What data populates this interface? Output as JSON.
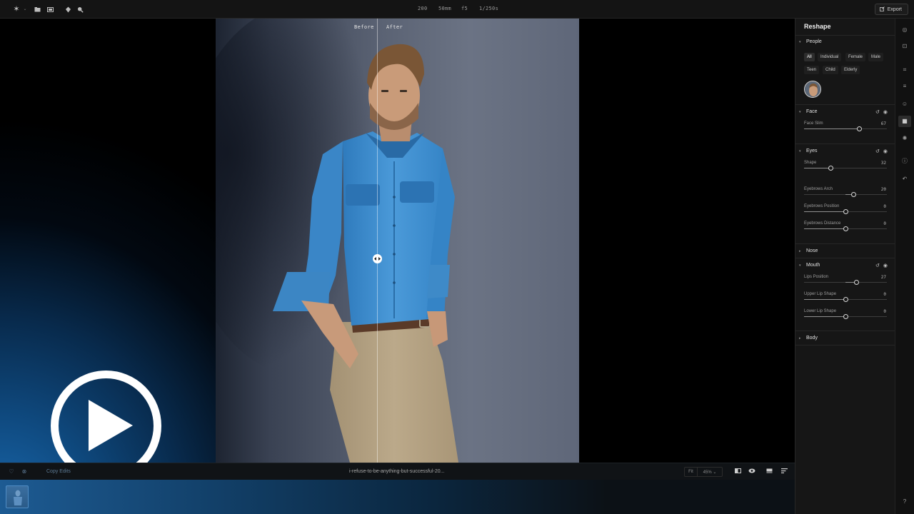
{
  "topbar": {
    "left_icons": [
      {
        "name": "app-logo-icon",
        "glyph": "✶"
      },
      {
        "name": "folder-icon",
        "glyph": "▬"
      },
      {
        "name": "library-icon",
        "glyph": "▭"
      },
      {
        "name": "pen-tool-icon",
        "glyph": "✎"
      },
      {
        "name": "zoom-icon",
        "glyph": "⚲"
      }
    ],
    "exif": {
      "iso": "200",
      "focal": "50mm",
      "aperture": "f5",
      "shutter": "1/250s"
    },
    "export_label": "Export"
  },
  "compare": {
    "before": "Before",
    "after": "After"
  },
  "bottom": {
    "copy_edits": "Copy Edits",
    "filename": "i-refuse-to-be-anything-but-successful-20...",
    "fit": "Fit",
    "zoom": "45% ⌄"
  },
  "panel": {
    "title": "Reshape",
    "people": {
      "title": "People",
      "chips_row1": [
        "All",
        "Individual",
        "Female",
        "Male"
      ],
      "chips_row2": [
        "Teen",
        "Child",
        "Elderly"
      ],
      "selected": "All"
    },
    "face": {
      "title": "Face",
      "sliders": [
        {
          "label": "Face Slim",
          "value": "67",
          "fraction": 0.67
        }
      ]
    },
    "eyes": {
      "title": "Eyes",
      "sliders": [
        {
          "label": "Shape",
          "value": "32",
          "fraction": 0.32
        },
        {
          "label": "Eyebrows Arch",
          "value": "20",
          "fraction": 0.6
        },
        {
          "label": "Eyebrows Position",
          "value": "0",
          "fraction": 0.5
        },
        {
          "label": "Eyebrows Distance",
          "value": "0",
          "fraction": 0.5
        }
      ]
    },
    "nose": {
      "title": "Nose"
    },
    "mouth": {
      "title": "Mouth",
      "sliders": [
        {
          "label": "Lips Position",
          "value": "27",
          "fraction": 0.635
        },
        {
          "label": "Upper Lip Shape",
          "value": "0",
          "fraction": 0.5
        },
        {
          "label": "Lower Lip Shape",
          "value": "0",
          "fraction": 0.5
        }
      ]
    },
    "body": {
      "title": "Body"
    }
  },
  "colors": {
    "accent_blue": "#1a6ab0",
    "panel_bg": "#161616",
    "shirt": "#3d8ed3",
    "pants": "#b4a386"
  }
}
